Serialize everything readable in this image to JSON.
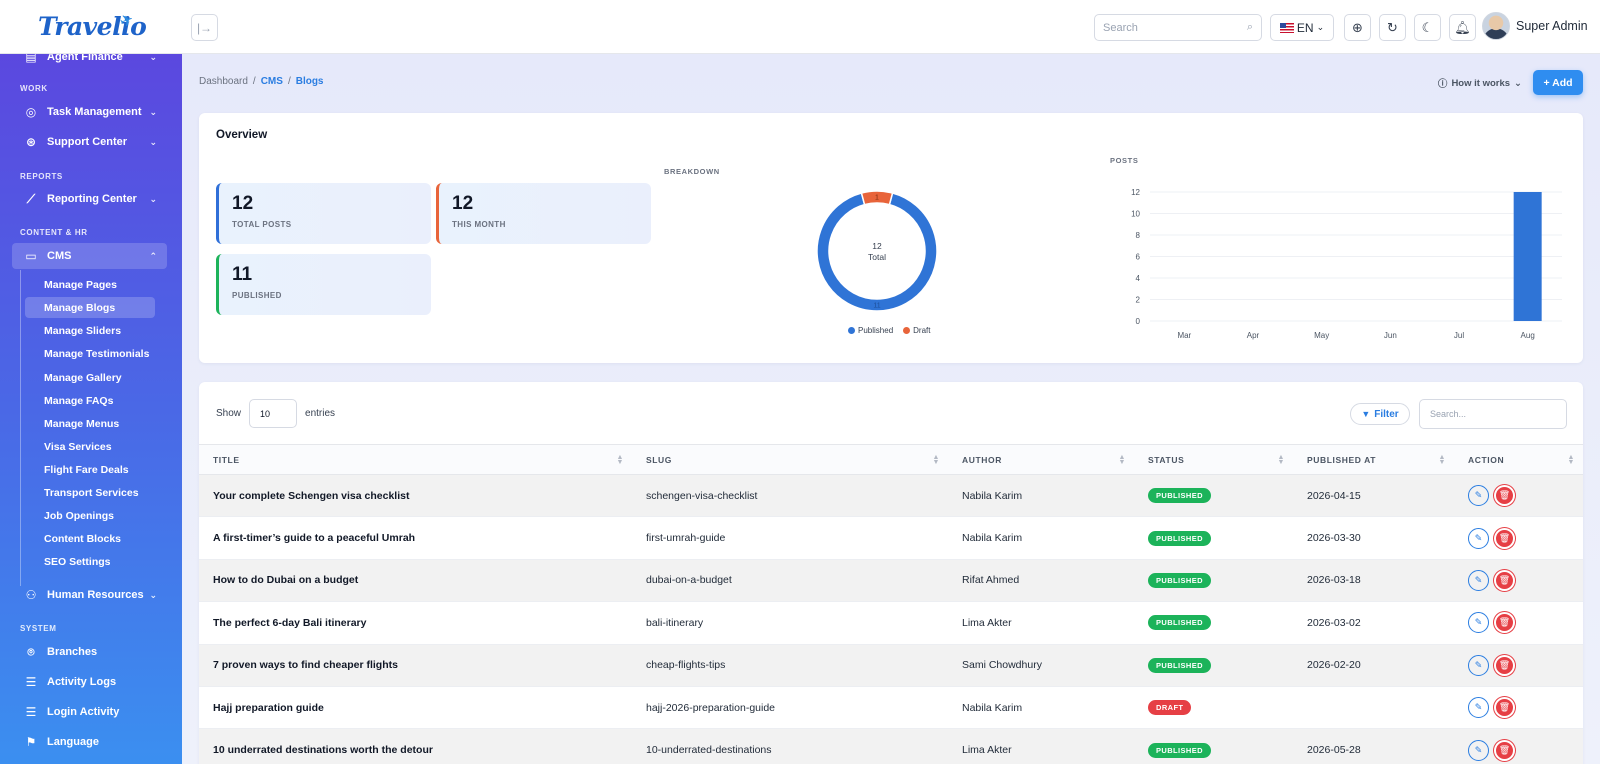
{
  "app": {
    "logo": "Travelio"
  },
  "topbar": {
    "search_placeholder": "Search",
    "lang": "EN",
    "user_name": "Super Admin"
  },
  "sidebar": {
    "top_items": [
      {
        "label": "Agent Finance"
      }
    ],
    "sections": {
      "work": "WORK",
      "reports": "REPORTS",
      "content_hr": "CONTENT & HR",
      "system": "SYSTEM"
    },
    "work_items": [
      {
        "label": "Task Management"
      },
      {
        "label": "Support Center"
      }
    ],
    "reports_items": [
      {
        "label": "Reporting Center"
      }
    ],
    "cms": {
      "label": "CMS"
    },
    "cms_sub": [
      "Manage Pages",
      "Manage Blogs",
      "Manage Sliders",
      "Manage Testimonials",
      "Manage Gallery",
      "Manage FAQs",
      "Manage Menus",
      "Visa Services",
      "Flight Fare Deals",
      "Transport Services",
      "Job Openings",
      "Content Blocks",
      "SEO Settings"
    ],
    "hr": {
      "label": "Human Resources"
    },
    "system_items": [
      {
        "label": "Branches"
      },
      {
        "label": "Activity Logs"
      },
      {
        "label": "Login Activity"
      },
      {
        "label": "Language"
      }
    ]
  },
  "breadcrumb": {
    "home": "Dashboard",
    "sep": "/",
    "cms": "CMS",
    "current": "Blogs"
  },
  "header": {
    "how_it_works": "How it works",
    "add": "+ Add"
  },
  "overview": {
    "title": "Overview",
    "stats": [
      {
        "value": "12",
        "label": "TOTAL POSTS",
        "color": "#2f6fd8"
      },
      {
        "value": "12",
        "label": "THIS MONTH",
        "color": "#e8643a"
      },
      {
        "value": "11",
        "label": "PUBLISHED",
        "color": "#1cb35a"
      }
    ],
    "breakdown_label": "BREAKDOWN",
    "posts_label": "POSTS"
  },
  "chart_data": [
    {
      "type": "pie",
      "title": "BREAKDOWN",
      "center_value": "12",
      "center_label": "Total",
      "slices": [
        {
          "name": "Published",
          "value": 11,
          "color": "#2f74d6"
        },
        {
          "name": "Draft",
          "value": 1,
          "color": "#e8643a"
        }
      ],
      "legend": "bottom"
    },
    {
      "type": "bar",
      "title": "POSTS",
      "categories": [
        "Mar",
        "Apr",
        "May",
        "Jun",
        "Jul",
        "Aug"
      ],
      "values": [
        0,
        0,
        0,
        0,
        0,
        12
      ],
      "ylim": [
        0,
        12
      ],
      "yticks": [
        "0",
        "2",
        "4",
        "6",
        "8",
        "10",
        "12"
      ],
      "color": "#2f74d6",
      "grid": true
    }
  ],
  "table": {
    "show_label": "Show",
    "entries_value": "10",
    "entries_label": "entries",
    "filter_label": "Filter",
    "search_placeholder": "Search...",
    "columns": [
      "TITLE",
      "SLUG",
      "AUTHOR",
      "STATUS",
      "PUBLISHED AT",
      "ACTION"
    ],
    "rows": [
      {
        "title": "Your complete Schengen visa checklist",
        "slug": "schengen-visa-checklist",
        "author": "Nabila Karim",
        "status": "PUBLISHED",
        "published_at": "2026-04-15"
      },
      {
        "title": "A first-timer’s guide to a peaceful Umrah",
        "slug": "first-umrah-guide",
        "author": "Nabila Karim",
        "status": "PUBLISHED",
        "published_at": "2026-03-30"
      },
      {
        "title": "How to do Dubai on a budget",
        "slug": "dubai-on-a-budget",
        "author": "Rifat Ahmed",
        "status": "PUBLISHED",
        "published_at": "2026-03-18"
      },
      {
        "title": "The perfect 6-day Bali itinerary",
        "slug": "bali-itinerary",
        "author": "Lima Akter",
        "status": "PUBLISHED",
        "published_at": "2026-03-02"
      },
      {
        "title": "7 proven ways to find cheaper flights",
        "slug": "cheap-flights-tips",
        "author": "Sami Chowdhury",
        "status": "PUBLISHED",
        "published_at": "2026-02-20"
      },
      {
        "title": "Hajj preparation guide",
        "slug": "hajj-2026-preparation-guide",
        "author": "Nabila Karim",
        "status": "DRAFT",
        "published_at": ""
      },
      {
        "title": "10 underrated destinations worth the detour",
        "slug": "10-underrated-destinations",
        "author": "Lima Akter",
        "status": "PUBLISHED",
        "published_at": "2026-05-28"
      }
    ]
  }
}
